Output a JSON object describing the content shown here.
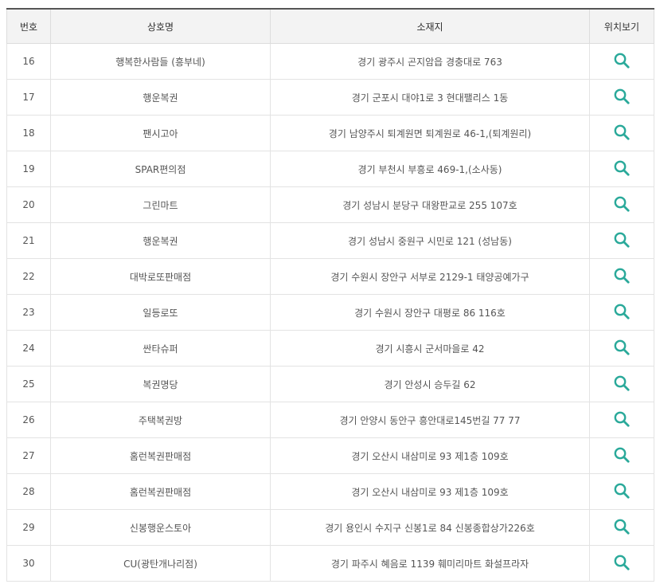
{
  "colors": {
    "accent": "#2aa99a",
    "header_bg": "#f3f3f3",
    "border": "#e3e3e3"
  },
  "table": {
    "headers": {
      "no": "번호",
      "name": "상호명",
      "address": "소재지",
      "map": "위치보기"
    },
    "map_icon": "search-icon",
    "rows": [
      {
        "no": "16",
        "name": "행복한사람들 (흥부네)",
        "address": "경기 광주시 곤지암읍 경충대로 763"
      },
      {
        "no": "17",
        "name": "행운복권",
        "address": "경기 군포시 대야1로 3 현대팰리스 1동"
      },
      {
        "no": "18",
        "name": "팬시고아",
        "address": "경기 남양주시 퇴계원면 퇴계원로 46-1,(퇴계원리)"
      },
      {
        "no": "19",
        "name": "SPAR편의점",
        "address": "경기 부천시 부흥로 469-1,(소사동)"
      },
      {
        "no": "20",
        "name": "그린마트",
        "address": "경기 성남시 분당구 대왕판교로 255 107호"
      },
      {
        "no": "21",
        "name": "행운복권",
        "address": "경기 성남시 중원구 시민로 121 (성남동)"
      },
      {
        "no": "22",
        "name": "대박로또판매점",
        "address": "경기 수원시 장안구 서부로 2129-1 태양공예가구"
      },
      {
        "no": "23",
        "name": "일등로또",
        "address": "경기 수원시 장안구 대평로 86 116호"
      },
      {
        "no": "24",
        "name": "싼타슈퍼",
        "address": "경기 시흥시 군서마을로 42"
      },
      {
        "no": "25",
        "name": "복권명당",
        "address": "경기 안성시 승두길 62"
      },
      {
        "no": "26",
        "name": "주택복권방",
        "address": "경기 안양시 동안구 흥안대로145번길 77 77"
      },
      {
        "no": "27",
        "name": "홈런복권판매점",
        "address": "경기 오산시 내삼미로 93 제1층 109호"
      },
      {
        "no": "28",
        "name": "홈런복권판매점",
        "address": "경기 오산시 내삼미로 93 제1층 109호"
      },
      {
        "no": "29",
        "name": "신봉행운스토아",
        "address": "경기 용인시 수지구 신봉1로 84 신봉종합상가226호"
      },
      {
        "no": "30",
        "name": "CU(광탄개나리점)",
        "address": "경기 파주시 혜음로 1139 훼미리마트 화설프라자"
      }
    ]
  }
}
